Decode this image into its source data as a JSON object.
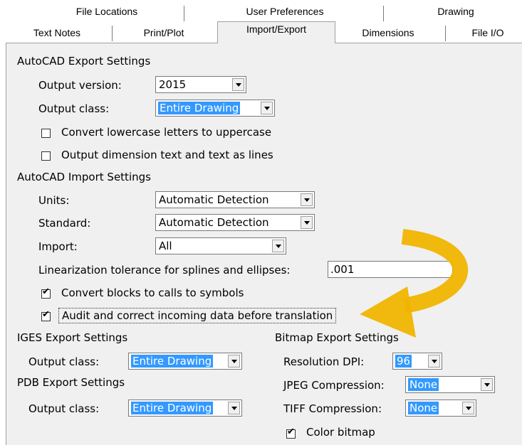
{
  "tabs_row1": [
    "File Locations",
    "User Preferences",
    "Drawing"
  ],
  "tabs_row2": [
    "Text Notes",
    "Print/Plot",
    "Import/Export",
    "Dimensions",
    "File I/O"
  ],
  "autocad_export": {
    "heading": "AutoCAD Export Settings",
    "output_version_label": "Output version:",
    "output_version_value": "2015",
    "output_class_label": "Output class:",
    "output_class_value": "Entire Drawing",
    "uppercase_label": "Convert lowercase letters to uppercase",
    "uppercase_checked": false,
    "dimension_lines_label": "Output dimension text and text as lines",
    "dimension_lines_checked": false
  },
  "autocad_import": {
    "heading": "AutoCAD Import Settings",
    "units_label": "Units:",
    "units_value": "Automatic Detection",
    "standard_label": "Standard:",
    "standard_value": "Automatic Detection",
    "import_label": "Import:",
    "import_value": "All",
    "tolerance_label": "Linearization tolerance for splines and ellipses:",
    "tolerance_value": ".001",
    "blocks_label": "Convert blocks to calls to symbols",
    "blocks_checked": true,
    "audit_label": "Audit and correct incoming data before translation",
    "audit_checked": true
  },
  "iges_export": {
    "heading": "IGES Export Settings",
    "output_class_label": "Output class:",
    "output_class_value": "Entire Drawing"
  },
  "pdb_export": {
    "heading": "PDB Export Settings",
    "output_class_label": "Output class:",
    "output_class_value": "Entire Drawing"
  },
  "bitmap_export": {
    "heading": "Bitmap Export Settings",
    "resolution_label": "Resolution DPI:",
    "resolution_value": "96",
    "jpeg_label": "JPEG Compression:",
    "jpeg_value": "None",
    "tiff_label": "TIFF Compression:",
    "tiff_value": "None",
    "color_bitmap_label": "Color bitmap",
    "color_bitmap_checked": true
  },
  "check_glyph": "✔",
  "colors": {
    "selection": "#3399ff",
    "panel": "#f0f0f0",
    "annotation_arrow": "#f0b400"
  }
}
